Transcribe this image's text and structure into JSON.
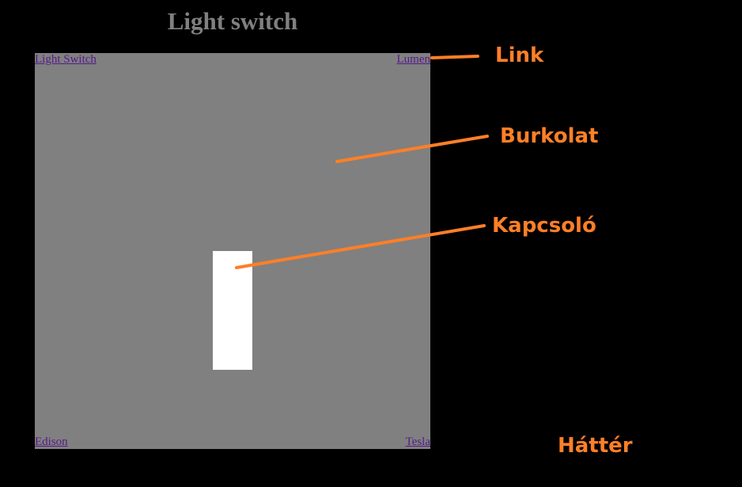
{
  "page": {
    "title": "Light switch",
    "background_color": "#000000"
  },
  "plate": {
    "color": "#808080",
    "links": {
      "top_left": "Light Switch",
      "top_right": "Lumen",
      "bottom_left": "Edison",
      "bottom_right": "Tesla"
    }
  },
  "switch": {
    "color": "#ffffff"
  },
  "annotations": {
    "color": "#ff7f27",
    "link": "Link",
    "burkolat": "Burkolat",
    "kapcsolo": "Kapcsoló",
    "hatter": "Háttér"
  }
}
